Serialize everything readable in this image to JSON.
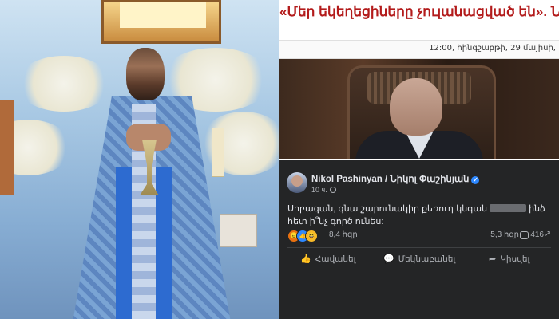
{
  "article": {
    "headline": "«Մեր եկեղեցիները չուլանացված են». Նիկոլ Փաշինյան",
    "datetime": "12:00, հինգշաբթի, 29 մայիսի,"
  },
  "facebook_post": {
    "author": "Nikol Pashinyan / Նիկոլ Փաշինյան",
    "verified_icon": "✓",
    "time": "10 ч.",
    "text_before": "Սրբազան, գնա շարունակիր քեռուդ կնգան",
    "text_after": "ինձ հետ ի՞նչ գործ ունես:",
    "reactions": {
      "icons": [
        "angry-icon",
        "like-icon",
        "haha-icon"
      ],
      "count": "8,4 հզր",
      "comments": "5,3 հզր",
      "shares": "416"
    },
    "actions": {
      "like": "Հավանել",
      "comment": "Մեկնաբանել",
      "share": "Կիսվել"
    }
  },
  "colors": {
    "headline_red": "#b31b1b",
    "fb_dark_bg": "#242526",
    "fb_blue": "#2d88ff"
  }
}
